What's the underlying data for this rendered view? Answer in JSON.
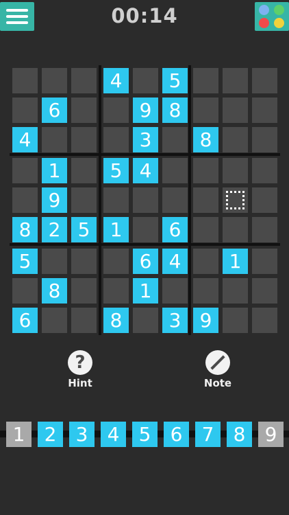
{
  "header": {
    "timer": "00:14"
  },
  "theme_colors": [
    "#7eb2f0",
    "#5ed06a",
    "#f24a4a",
    "#f2d23c"
  ],
  "board": {
    "rows": [
      [
        0,
        0,
        0,
        4,
        0,
        5,
        0,
        0,
        0
      ],
      [
        0,
        6,
        0,
        0,
        9,
        8,
        0,
        0,
        0
      ],
      [
        4,
        0,
        0,
        0,
        3,
        0,
        8,
        0,
        0
      ],
      [
        0,
        1,
        0,
        5,
        4,
        0,
        0,
        0,
        0
      ],
      [
        0,
        9,
        0,
        0,
        0,
        0,
        0,
        0,
        0
      ],
      [
        8,
        2,
        5,
        1,
        0,
        6,
        0,
        0,
        0
      ],
      [
        5,
        0,
        0,
        0,
        6,
        4,
        0,
        1,
        0
      ],
      [
        0,
        8,
        0,
        0,
        1,
        0,
        0,
        0,
        0
      ],
      [
        6,
        0,
        0,
        8,
        0,
        3,
        9,
        0,
        0
      ]
    ],
    "selected": [
      4,
      7
    ]
  },
  "tools": {
    "hint_label": "Hint",
    "hint_glyph": "?",
    "note_label": "Note"
  },
  "numpad": [
    "1",
    "2",
    "3",
    "4",
    "5",
    "6",
    "7",
    "8",
    "9"
  ],
  "numpad_done": [
    "1",
    "9"
  ]
}
